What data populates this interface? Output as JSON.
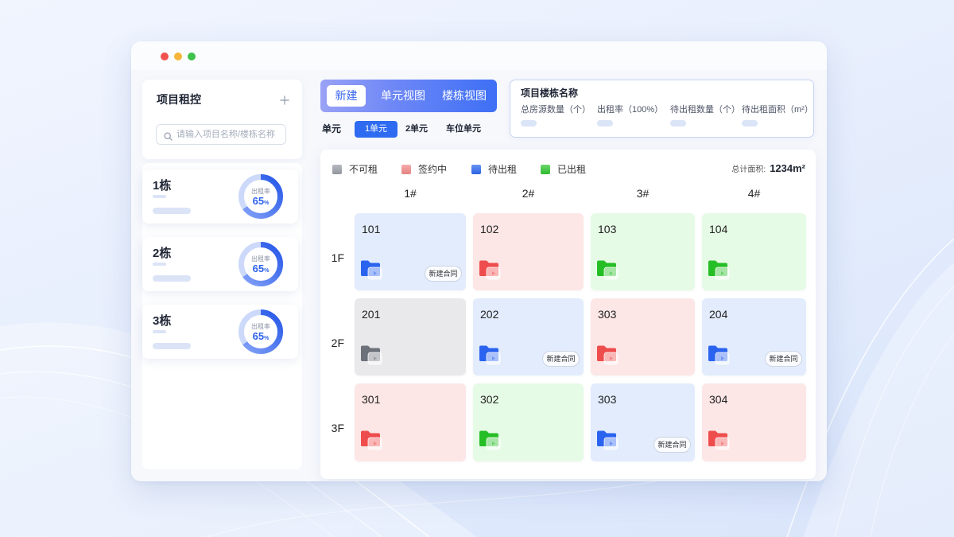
{
  "window": {
    "controls": [
      "#f1524f",
      "#f6b63b",
      "#3ec24b"
    ]
  },
  "sidebar": {
    "title": "项目租控",
    "add_icon": "plus-icon",
    "search_icon": "search-icon",
    "search_placeholder": "请输入项目名称/楼栋名称",
    "buildings": [
      {
        "name": "1栋",
        "rate_label": "出租率",
        "rate_value": "65",
        "rate_unit": "%",
        "rate": 0.65
      },
      {
        "name": "2栋",
        "rate_label": "出租率",
        "rate_value": "65",
        "rate_unit": "%",
        "rate": 0.65
      },
      {
        "name": "3栋",
        "rate_label": "出租率",
        "rate_value": "65",
        "rate_unit": "%",
        "rate": 0.65
      }
    ]
  },
  "view_tabs": {
    "items": [
      "新建",
      "单元视图",
      "楼栋视图"
    ],
    "active_index": 0
  },
  "unit_tabs": {
    "label": "单元",
    "items": [
      "1单元",
      "2单元",
      "车位单元"
    ],
    "active_index": 0
  },
  "summary": {
    "title": "项目楼栋名称",
    "stats": [
      {
        "label": "总房源数量（个）"
      },
      {
        "label": "出租率（100%）"
      },
      {
        "label": "待出租数量（个）"
      },
      {
        "label": "待出租面积（m²）"
      }
    ]
  },
  "legend": [
    {
      "label": "不可租",
      "color": "#9b9fa7",
      "cell_bg": "#e9e9eb",
      "icon_color": "#6c717a"
    },
    {
      "label": "签约中",
      "color": "#f38b8b",
      "cell_bg": "#fde6e6",
      "icon_color": "#ee4d4d"
    },
    {
      "label": "待出租",
      "color": "#2f69f0",
      "cell_bg": "#e2ecfd",
      "icon_color": "#2a63ee"
    },
    {
      "label": "已出租",
      "color": "#33c633",
      "cell_bg": "#e6fbe6",
      "icon_color": "#26be26"
    }
  ],
  "total_area": {
    "label": "总计面积:",
    "value": "1234m²"
  },
  "columns": [
    "1#",
    "2#",
    "3#",
    "4#"
  ],
  "room_icon": "folder-icon",
  "floors": [
    {
      "label": "1F",
      "rooms": [
        {
          "number": "101",
          "legend_index": 2,
          "action": "新建合同"
        },
        {
          "number": "102",
          "legend_index": 1
        },
        {
          "number": "103",
          "legend_index": 3
        },
        {
          "number": "104",
          "legend_index": 3
        }
      ]
    },
    {
      "label": "2F",
      "rooms": [
        {
          "number": "201",
          "legend_index": 0
        },
        {
          "number": "202",
          "legend_index": 2,
          "action": "新建合同"
        },
        {
          "number": "303",
          "legend_index": 1
        },
        {
          "number": "204",
          "legend_index": 2,
          "action": "新建合同"
        }
      ]
    },
    {
      "label": "3F",
      "rooms": [
        {
          "number": "301",
          "legend_index": 1
        },
        {
          "number": "302",
          "legend_index": 3
        },
        {
          "number": "303",
          "legend_index": 2,
          "action": "新建合同"
        },
        {
          "number": "304",
          "legend_index": 1
        }
      ]
    }
  ]
}
